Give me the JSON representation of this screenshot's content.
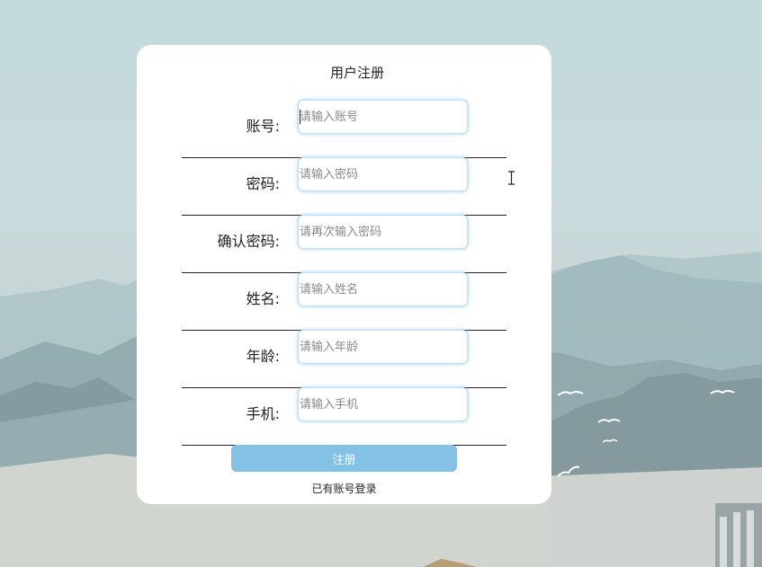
{
  "form": {
    "title": "用户注册",
    "fields": [
      {
        "label": "账号:",
        "placeholder": "请输入账号",
        "value": ""
      },
      {
        "label": "密码:",
        "placeholder": "请输入密码",
        "value": ""
      },
      {
        "label": "确认密码:",
        "placeholder": "请再次输入密码",
        "value": ""
      },
      {
        "label": "姓名:",
        "placeholder": "请输入姓名",
        "value": ""
      },
      {
        "label": "年龄:",
        "placeholder": "请输入年龄",
        "value": ""
      },
      {
        "label": "手机:",
        "placeholder": "请输入手机",
        "value": ""
      }
    ],
    "submit_label": "注册",
    "login_link": "已有账号登录"
  },
  "colors": {
    "button": "#84c1e6",
    "field_border": "#bfe0f2",
    "card": "#ffffff"
  }
}
